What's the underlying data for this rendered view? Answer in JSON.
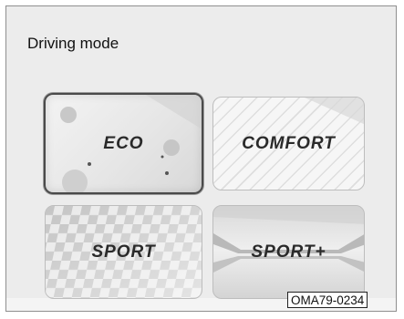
{
  "screen": {
    "title": "Driving mode"
  },
  "modes": [
    {
      "id": "eco",
      "label": "ECO",
      "selected": true
    },
    {
      "id": "comfort",
      "label": "COMFORT",
      "selected": false
    },
    {
      "id": "sport",
      "label": "SPORT",
      "selected": false
    },
    {
      "id": "sport_plus",
      "label": "SPORT+",
      "selected": false
    }
  ],
  "figure_ref": "OMA79-0234",
  "colors": {
    "background": "#ececec",
    "label_text": "#2a2a2a",
    "selected_border": "#4a4a4a",
    "tile_border": "#bdbdbd"
  }
}
